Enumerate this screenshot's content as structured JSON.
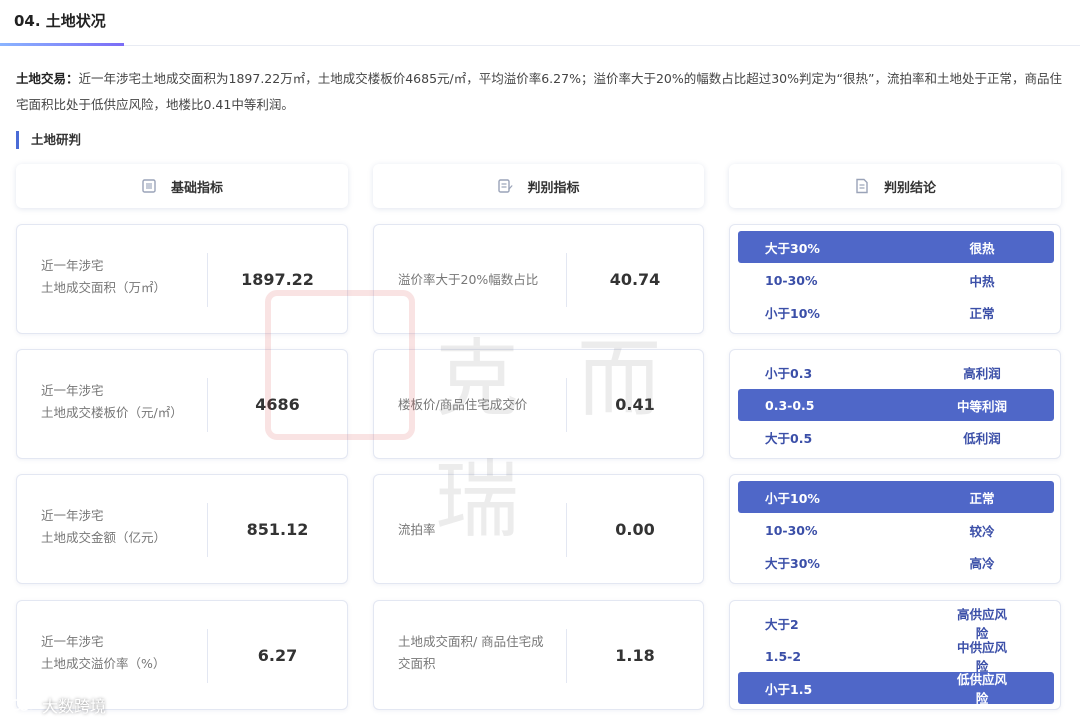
{
  "section": {
    "title": "04. 土地状况"
  },
  "summary": {
    "label": "土地交易：",
    "text": "近一年涉宅土地成交面积为1897.22万㎡，土地成交楼板价4685元/㎡，平均溢价率6.27%；溢价率大于20%的幅数占比超过30%判定为“很热”，流拍率和土地处于正常，商品住宅面积比处于低供应风险，地楼比0.41中等利润。"
  },
  "subhead": "土地研判",
  "columns": {
    "basic": "基础指标",
    "judge": "判别指标",
    "conclusion": "判别结论"
  },
  "basic": [
    {
      "line1": "近一年涉宅",
      "line2": "土地成交面积（万㎡）",
      "value": "1897.22"
    },
    {
      "line1": "近一年涉宅",
      "line2": "土地成交楼板价（元/㎡）",
      "value": "4686"
    },
    {
      "line1": "近一年涉宅",
      "line2": "土地成交金额（亿元）",
      "value": "851.12"
    },
    {
      "line1": "近一年涉宅",
      "line2": "土地成交溢价率（%）",
      "value": "6.27"
    }
  ],
  "judge": [
    {
      "line1": "溢价率大于20%幅数占比",
      "line2": "",
      "value": "40.74"
    },
    {
      "line1": "楼板价/商品住宅成交价",
      "line2": "",
      "value": "0.41"
    },
    {
      "line1": "流拍率",
      "line2": "",
      "value": "0.00"
    },
    {
      "line1": "土地成交面积/ 商品住宅成",
      "line2": "交面积",
      "value": "1.18"
    }
  ],
  "rules": [
    {
      "rows": [
        {
          "k": "大于30%",
          "v": "很热"
        },
        {
          "k": "10-30%",
          "v": "中热"
        },
        {
          "k": "小于10%",
          "v": "正常"
        }
      ],
      "active": 0
    },
    {
      "rows": [
        {
          "k": "小于0.3",
          "v": "高利润"
        },
        {
          "k": "0.3-0.5",
          "v": "中等利润"
        },
        {
          "k": "大于0.5",
          "v": "低利润"
        }
      ],
      "active": 1
    },
    {
      "rows": [
        {
          "k": "小于10%",
          "v": "正常"
        },
        {
          "k": "10-30%",
          "v": "较冷"
        },
        {
          "k": "大于30%",
          "v": "高冷"
        }
      ],
      "active": 0
    },
    {
      "rows": [
        {
          "k": "大于2",
          "v": "高供应风险"
        },
        {
          "k": "1.5-2",
          "v": "中供应风险"
        },
        {
          "k": "小于1.5",
          "v": "低供应风险"
        }
      ],
      "active": 2
    }
  ],
  "watermark": {
    "text": "克而瑞"
  },
  "footer_logo": {
    "text": "大数跨境"
  },
  "colors": {
    "accent": "#4f67c8",
    "rule_text": "#3b4fa8",
    "underline_start": "#8ab4ff",
    "underline_end": "#7b6cf6"
  }
}
